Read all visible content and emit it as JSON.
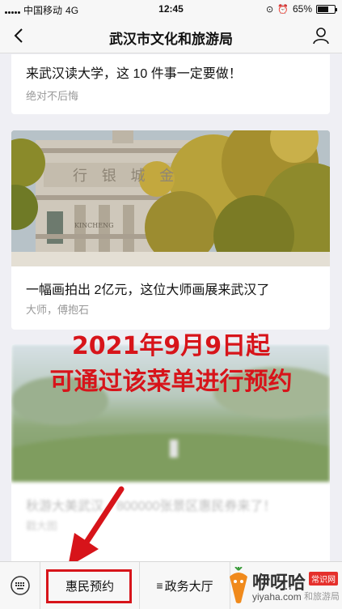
{
  "status": {
    "carrier": "中国移动",
    "network": "4G",
    "time": "12:45",
    "battery_text": "65%",
    "battery_level": 0.65
  },
  "nav": {
    "title": "武汉市文化和旅游局"
  },
  "articles": [
    {
      "title": "来武汉读大学，这 10 件事一定要做！",
      "sub": "绝对不后悔"
    },
    {
      "title": "一幅画拍出 2亿元，这位大师画展来武汉了",
      "sub": "大师，傅抱石",
      "image_text_top": "行 银 城 金",
      "image_text_bottom": "KINCHENG"
    },
    {
      "title": "秋游大美武汉，800000张景区惠民券来了！",
      "sub": "戳大图"
    }
  ],
  "overlay": {
    "line1": "2021年9月9日起",
    "line2": "可通过该菜单进行预约"
  },
  "menu": {
    "item1": "惠民预约",
    "item2": "政务大厅",
    "item3": "…"
  },
  "watermark": {
    "brand": "咿呀哈",
    "tag": "常识网",
    "url": "yiyaha.com",
    "tail": "和旅游局"
  },
  "colors": {
    "accent_red": "#d7141a",
    "bg": "#efeff4"
  }
}
